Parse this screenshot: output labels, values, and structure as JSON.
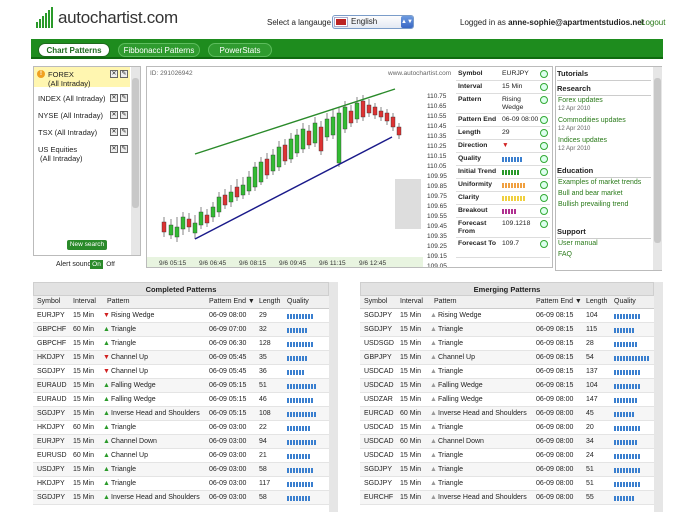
{
  "header": {
    "logo_text": "autochartist.com",
    "language_label": "Select a langauge",
    "language_value": "English",
    "login_prefix": "Logged in as",
    "login_user": "anne-sophie@apartmentstudios.net",
    "logout": "Logout"
  },
  "nav": {
    "tabs": [
      "Chart Patterns",
      "Fibbonacci Patterns",
      "PowerStats"
    ]
  },
  "left_list": {
    "items": [
      {
        "label": "FOREX (All Intraday)",
        "line1": "FOREX",
        "line2": "(All Intraday)"
      },
      {
        "label": "INDEX (All Intraday)",
        "line1": "INDEX (All Intraday)",
        "line2": ""
      },
      {
        "label": "NYSE (All Intraday)",
        "line1": "NYSE (All Intraday)",
        "line2": ""
      },
      {
        "label": "TSX (All Intraday)",
        "line1": "TSX (All Intraday)",
        "line2": ""
      },
      {
        "label": "US Equities (All Intraday)",
        "line1": "US Equities",
        "line2": "(All Intraday)"
      }
    ],
    "new_search": "New search",
    "alert_label": "Alert sound",
    "alert_on": "On",
    "alert_off": "Off"
  },
  "chart": {
    "id_label": "ID: 291026942",
    "watermark": "www.autochartist.com",
    "y_ticks": [
      "110.75",
      "110.65",
      "110.55",
      "110.45",
      "110.35",
      "110.25",
      "110.15",
      "110.05",
      "109.95",
      "109.85",
      "109.75",
      "109.65",
      "109.55",
      "109.45",
      "109.35",
      "109.25",
      "109.15",
      "109.05",
      "108.95"
    ],
    "x_ticks": [
      "9/6 05:15",
      "9/6 06:45",
      "9/6 08:15",
      "9/6 09:45",
      "9/6 11:15",
      "9/6 12:45"
    ]
  },
  "info": {
    "rows": [
      {
        "key": "Symbol",
        "value": "EURJPY"
      },
      {
        "key": "Interval",
        "value": "15 Min"
      },
      {
        "key": "Pattern",
        "value": "Rising Wedge"
      },
      {
        "key": "Pattern End",
        "value": "06-09 08:00"
      },
      {
        "key": "Length",
        "value": "29"
      },
      {
        "key": "Direction",
        "value": "▼"
      },
      {
        "key": "Quality",
        "value": ""
      },
      {
        "key": "Initial Trend",
        "value": ""
      },
      {
        "key": "Uniformity",
        "value": ""
      },
      {
        "key": "Clarity",
        "value": ""
      },
      {
        "key": "Breakout",
        "value": ""
      },
      {
        "key": "Forecast From",
        "value": "109.1218"
      },
      {
        "key": "Forecast To",
        "value": "109.7"
      }
    ]
  },
  "right_panel": {
    "tutorials": "Tutorials",
    "research": "Research",
    "research_items": [
      {
        "title": "Forex updates",
        "date": "12 Apr 2010"
      },
      {
        "title": "Commodities updates",
        "date": "12 Apr 2010"
      },
      {
        "title": "Indices updates",
        "date": "12 Apr 2010"
      }
    ],
    "education": "Education",
    "education_items": [
      "Examples of market trends",
      "Bull and bear market",
      "Bullish prevailing trend"
    ],
    "support": "Support",
    "support_items": [
      "User manual",
      "FAQ"
    ]
  },
  "completed": {
    "title": "Completed Patterns",
    "headers": [
      "Symbol",
      "Interval",
      "Pattern",
      "Pattern End ▼",
      "Length",
      "Quality"
    ],
    "rows": [
      [
        "EURJPY",
        "15 Min",
        "Rising Wedge",
        "06-09 08:00",
        "29",
        "down",
        9
      ],
      [
        "GBPCHF",
        "60 Min",
        "Triangle",
        "06-09 07:00",
        "32",
        "up",
        7
      ],
      [
        "GBPCHF",
        "15 Min",
        "Triangle",
        "06-09 06:30",
        "128",
        "up",
        9
      ],
      [
        "HKDJPY",
        "15 Min",
        "Channel Up",
        "06-09 05:45",
        "35",
        "down",
        7
      ],
      [
        "SGDJPY",
        "15 Min",
        "Channel Up",
        "06-09 05:45",
        "36",
        "down",
        6
      ],
      [
        "EURAUD",
        "15 Min",
        "Falling Wedge",
        "06-09 05:15",
        "51",
        "up",
        10
      ],
      [
        "EURAUD",
        "15 Min",
        "Falling Wedge",
        "06-09 05:15",
        "46",
        "up",
        9
      ],
      [
        "SGDJPY",
        "15 Min",
        "Inverse Head and Shoulders",
        "06-09 05:15",
        "108",
        "up",
        10
      ],
      [
        "HKDJPY",
        "60 Min",
        "Triangle",
        "06-09 03:00",
        "22",
        "up",
        8
      ],
      [
        "EURJPY",
        "15 Min",
        "Channel Down",
        "06-09 03:00",
        "94",
        "up",
        10
      ],
      [
        "EURUSD",
        "60 Min",
        "Channel Up",
        "06-09 03:00",
        "21",
        "up",
        8
      ],
      [
        "USDJPY",
        "15 Min",
        "Triangle",
        "06-09 03:00",
        "58",
        "up",
        9
      ],
      [
        "HKDJPY",
        "15 Min",
        "Triangle",
        "06-09 03:00",
        "117",
        "up",
        9
      ],
      [
        "SGDJPY",
        "15 Min",
        "Inverse Head and Shoulders",
        "06-09 03:00",
        "58",
        "up",
        8
      ]
    ]
  },
  "emerging": {
    "title": "Emerging Patterns",
    "headers": [
      "Symbol",
      "Interval",
      "Pattern",
      "Pattern End ▼",
      "Length",
      "Quality"
    ],
    "rows": [
      [
        "SGDJPY",
        "15 Min",
        "Rising Wedge",
        "06-09 08:15",
        "104",
        "flat",
        9
      ],
      [
        "SGDJPY",
        "15 Min",
        "Triangle",
        "06-09 08:15",
        "115",
        "flat",
        7
      ],
      [
        "USDSGD",
        "15 Min",
        "Triangle",
        "06-09 08:15",
        "28",
        "flat",
        8
      ],
      [
        "GBPJPY",
        "15 Min",
        "Channel Up",
        "06-09 08:15",
        "54",
        "flat",
        12
      ],
      [
        "USDCAD",
        "15 Min",
        "Triangle",
        "06-09 08:15",
        "137",
        "flat",
        9
      ],
      [
        "USDCAD",
        "15 Min",
        "Falling Wedge",
        "06-09 08:15",
        "104",
        "flat",
        9
      ],
      [
        "USDZAR",
        "15 Min",
        "Falling Wedge",
        "06-09 08:00",
        "147",
        "flat",
        8
      ],
      [
        "EURCAD",
        "60 Min",
        "Inverse Head and Shoulders",
        "06-09 08:00",
        "45",
        "flat",
        7
      ],
      [
        "USDCAD",
        "15 Min",
        "Triangle",
        "06-09 08:00",
        "20",
        "flat",
        9
      ],
      [
        "USDCAD",
        "60 Min",
        "Channel Down",
        "06-09 08:00",
        "34",
        "flat",
        8
      ],
      [
        "USDCAD",
        "15 Min",
        "Triangle",
        "06-09 08:00",
        "24",
        "flat",
        9
      ],
      [
        "SGDJPY",
        "15 Min",
        "Triangle",
        "06-09 08:00",
        "51",
        "flat",
        9
      ],
      [
        "SGDJPY",
        "15 Min",
        "Triangle",
        "06-09 08:00",
        "51",
        "flat",
        9
      ],
      [
        "EURCHF",
        "15 Min",
        "Inverse Head and Shoulders",
        "06-09 08:00",
        "55",
        "flat",
        7
      ]
    ]
  },
  "colors": {
    "accent": "#1e8c1e",
    "up": "#2a9a2a",
    "down": "#d02020",
    "quality": "#3a7fcf"
  }
}
